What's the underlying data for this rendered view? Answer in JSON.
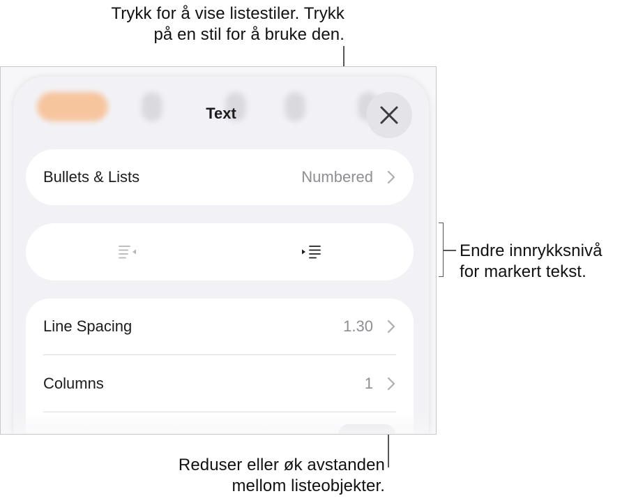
{
  "callouts": {
    "top": [
      "Trykk for å vise listestiler. Trykk",
      "på en stil for å bruke den."
    ],
    "right": [
      "Endre innrykksnivå",
      "for markert tekst."
    ],
    "bottom": [
      "Reduser eller øk avstanden",
      "mellom listeobjekter."
    ]
  },
  "panel": {
    "title": "Text",
    "close_icon": "close-icon",
    "bullets": {
      "label": "Bullets & Lists",
      "value": "Numbered"
    },
    "indent": {
      "decrease_icon": "outdent-icon",
      "increase_icon": "indent-icon"
    },
    "line_spacing": {
      "label": "Line Spacing",
      "value": "1.30"
    },
    "columns": {
      "label": "Columns",
      "value": "1"
    }
  },
  "colors": {
    "accent_blurred": "#f9b27a",
    "panel_bg": "#f2f2f6",
    "card_bg": "#ffffff",
    "secondary_text": "#8e8e93"
  }
}
